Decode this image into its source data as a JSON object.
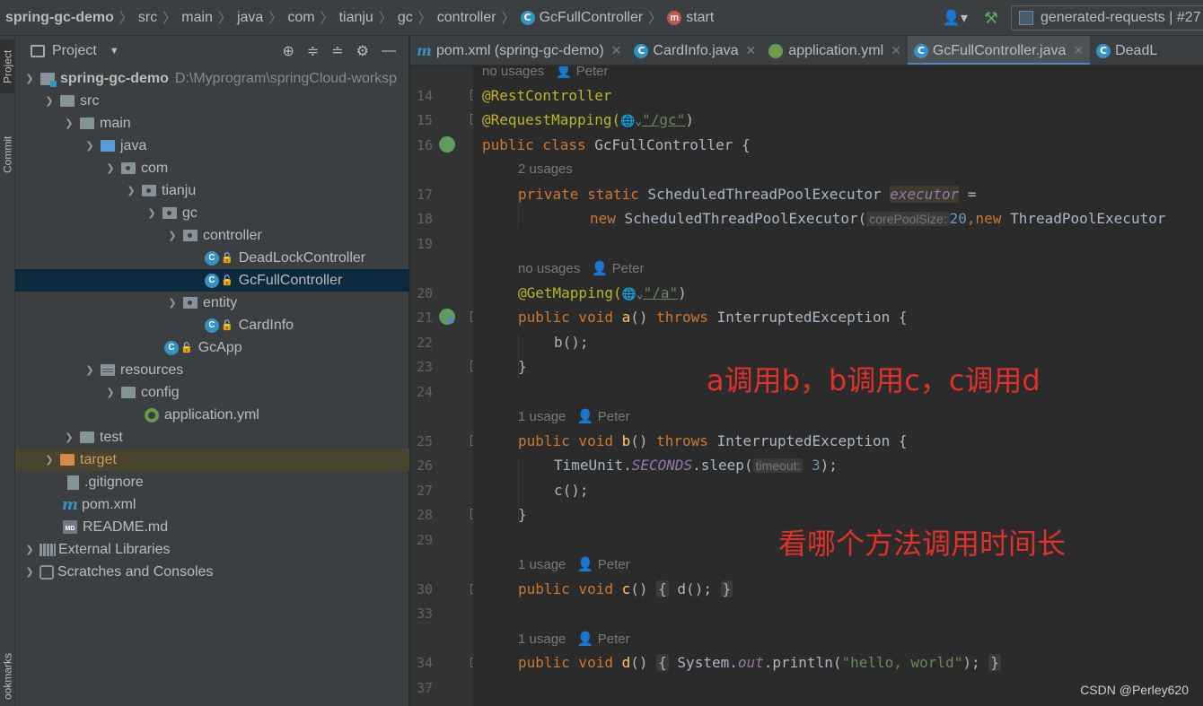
{
  "breadcrumb": {
    "project": "spring-gc-demo",
    "items": [
      "src",
      "main",
      "java",
      "com",
      "tianju",
      "gc",
      "controller"
    ],
    "class_name": "GcFullController",
    "method_name": "start"
  },
  "run_config": {
    "label": "generated-requests | #27"
  },
  "left_strip": {
    "project_tab": "Project",
    "commit_tab": "Commit",
    "bookmarks_tab": "ookmarks"
  },
  "project_panel": {
    "title": "Project"
  },
  "tree": {
    "root_name": "spring-gc-demo",
    "root_path": "D:\\Myprogram\\springCloud-worksp",
    "src": "src",
    "main": "main",
    "java": "java",
    "com": "com",
    "tianju": "tianju",
    "gc": "gc",
    "controller": "controller",
    "deadlock": "DeadLockController",
    "gcfull": "GcFullController",
    "entity": "entity",
    "cardinfo": "CardInfo",
    "gcapp": "GcApp",
    "resources": "resources",
    "config": "config",
    "appyml": "application.yml",
    "test": "test",
    "target": "target",
    "gitignore": ".gitignore",
    "pom": "pom.xml",
    "readme": "README.md",
    "extlib": "External Libraries",
    "scratches": "Scratches and Consoles"
  },
  "tabs": {
    "pom": "pom.xml (spring-gc-demo)",
    "cardinfo": "CardInfo.java",
    "appyml": "application.yml",
    "gcfull": "GcFullController.java",
    "deadlock": "DeadL"
  },
  "editor": {
    "line_numbers": [
      "14",
      "15",
      "16",
      "17",
      "18",
      "19",
      "20",
      "21",
      "22",
      "23",
      "24",
      "25",
      "26",
      "27",
      "28",
      "29",
      "30",
      "33",
      "34",
      "37"
    ],
    "hint_no_usages": "no usages",
    "hint_2_usages": "2 usages",
    "hint_1_usage": "1 usage",
    "author": "Peter",
    "param_corePoolSize": "corePoolSize:",
    "param_timeout": "timeout:",
    "code": {
      "l14": "@RestController",
      "l15_a": "@RequestMapping(",
      "l15_b": "\"/gc\"",
      "l15_c": ")",
      "l16_kw": "public class ",
      "l16_rest": "GcFullController {",
      "l17_kw": "private static ",
      "l17_type": "ScheduledThreadPoolExecutor ",
      "l17_field": "executor",
      "l17_eq": " =",
      "l18_kw": "new ",
      "l18_type": "ScheduledThreadPoolExecutor(",
      "l18_num": "20",
      "l18_rest": "ThreadPoolExecutor",
      "l18_new2": ",new ",
      "l20_a": "@GetMapping(",
      "l20_b": "\"/a\"",
      "l20_c": ")",
      "l21_kw": "public void ",
      "l21_fn": "a",
      "l21_mid": "() ",
      "l21_kw2": "throws ",
      "l21_rest": "InterruptedException {",
      "l22": "b();",
      "l23": "}",
      "l25_fn": "b",
      "l26_a": "TimeUnit.",
      "l26_b": "SECONDS",
      "l26_c": ".sleep(",
      "l26_num": "3",
      "l26_d": ");",
      "l27": "c();",
      "l28": "}",
      "l30_fn": "c",
      "l30_body": "d();",
      "l34_fn": "d",
      "l34_a": "System.",
      "l34_b": "out",
      "l34_c": ".println(",
      "l34_str": "\"hello, world\"",
      "l34_d": ");",
      "open_brace": "{",
      "close_brace": "}",
      "empty_parens": "() "
    }
  },
  "annotations": {
    "call_chain": "a调用b，b调用c，c调用d",
    "which_longer": "看哪个方法调用时间长"
  },
  "watermark": "CSDN @Perley620",
  "colors": {
    "keyword": "#cc7832",
    "annotation": "#bbb529",
    "string": "#6a8759",
    "function": "#ffc66d",
    "number": "#6897bb",
    "field": "#9876aa",
    "annotation_text": "#e0312b",
    "selection": "#0d293e",
    "active_tab_underline": "#4a88c7"
  }
}
